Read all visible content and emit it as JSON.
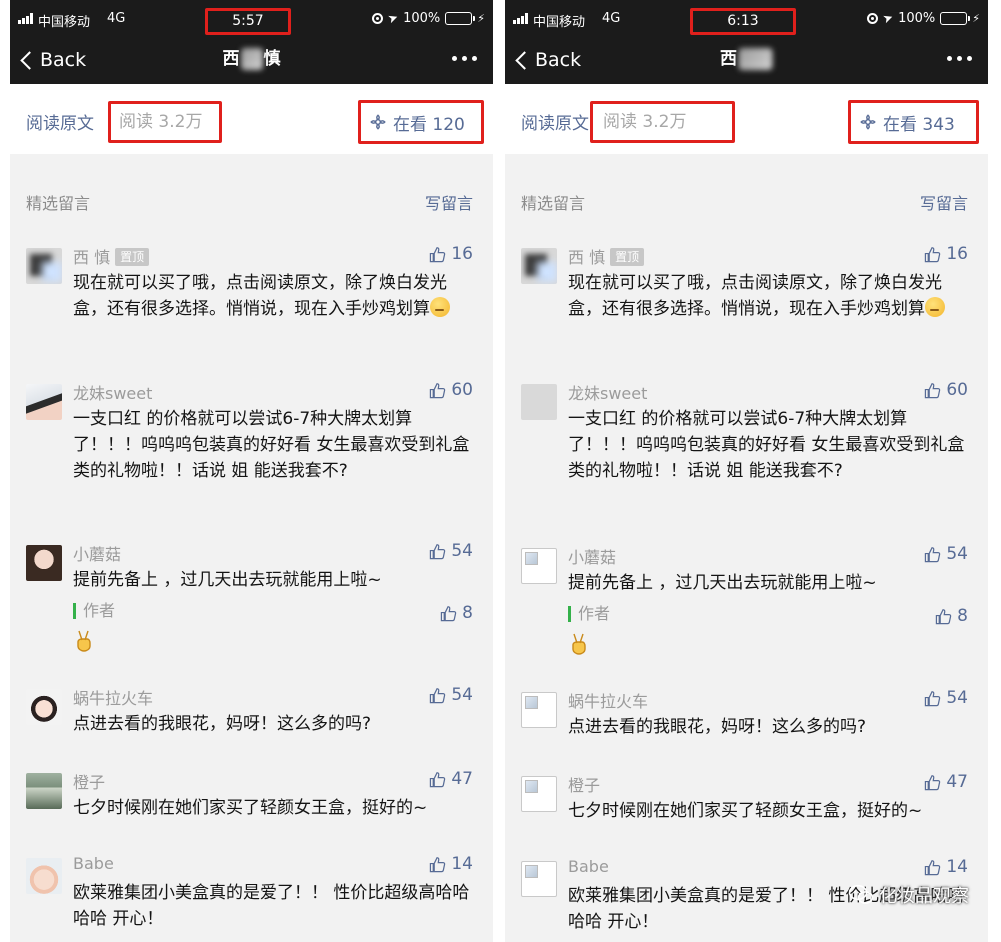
{
  "screens": [
    {
      "status": {
        "carrier": "中国移动",
        "network": "4G",
        "time": "5:57",
        "battery": "100%"
      },
      "nav": {
        "back_label": "Back",
        "title_left": "西",
        "title_right": "慎"
      },
      "stats": {
        "read_original": "阅读原文",
        "read_count": "阅读 3.2万",
        "watching": "在看 120"
      },
      "comments_header": {
        "title": "精选留言",
        "write": "写留言"
      },
      "comments": [
        {
          "name": "西    慎",
          "badge": "置顶",
          "likes": "16",
          "text": "现在就可以买了哦，点击阅读原文，除了焕白发光盒，还有很多选择。悄悄说，现在入手炒鸡划算",
          "emoji": "smiling-face"
        },
        {
          "name": "龙妹sweet",
          "likes": "60",
          "text": "一支口红   的价格就可以尝试6-7种大牌太划算了！！！呜呜呜包装真的好好看 女生最喜欢受到礼盒类的礼物啦！！话说 姐 能送我套不?"
        },
        {
          "name": "小蘑菇",
          "likes": "54",
          "text": "提前先备上   ，过几天出去玩就能用上啦~",
          "reply": {
            "label": "作者",
            "likes": "8"
          }
        },
        {
          "name": "蜗牛拉火车",
          "likes": "54",
          "text": "点进去看的我眼花，妈呀！这么多的吗?"
        },
        {
          "name": "橙子",
          "likes": "47",
          "text": "七夕时候刚在她们家买了轻颜女王盒，挺好的~"
        },
        {
          "name": "Babe",
          "likes": "14",
          "text": "欧莱雅集团小美盒真的是爱了！！ 性价比超级高哈哈哈哈 开心！"
        }
      ]
    },
    {
      "status": {
        "carrier": "中国移动",
        "network": "4G",
        "time": "6:13",
        "battery": "100%"
      },
      "nav": {
        "back_label": "Back",
        "title_left": "西",
        "title_right": ""
      },
      "stats": {
        "read_original": "阅读原文",
        "read_count": "阅读 3.2万",
        "watching": "在看 343"
      },
      "comments_header": {
        "title": "精选留言",
        "write": "写留言"
      },
      "comments": [
        {
          "name": "西    慎",
          "badge": "置顶",
          "likes": "16",
          "text": "现在就可以买了哦，点击阅读原文，除了焕白发光盒，还有很多选择。悄悄说，现在入手炒鸡划算",
          "emoji": "smiling-face"
        },
        {
          "name": "龙妹sweet",
          "likes": "60",
          "text": "一支口红   的价格就可以尝试6-7种大牌太划算了！！！呜呜呜包装真的好好看 女生最喜欢受到礼盒类的礼物啦！！话说 姐 能送我套不?"
        },
        {
          "name": "小蘑菇",
          "likes": "54",
          "text": "提前先备上   ，过几天出去玩就能用上啦~",
          "reply": {
            "label": "作者",
            "likes": "8"
          }
        },
        {
          "name": "蜗牛拉火车",
          "likes": "54",
          "text": "点进去看的我眼花，妈呀！这么多的吗?"
        },
        {
          "name": "橙子",
          "likes": "47",
          "text": "七夕时候刚在她们家买了轻颜女王盒，挺好的~"
        },
        {
          "name": "Babe",
          "likes": "14",
          "text": "欧莱雅集团小美盒真的是爱了！！ 性价比超级高哈哈哈哈 开心！"
        }
      ]
    }
  ],
  "watermark": "化妆品观察",
  "colors": {
    "link": "#576b95",
    "highlight_box": "#e0201c",
    "nav_bg": "#1b1b1b",
    "battery": "#35c759"
  }
}
